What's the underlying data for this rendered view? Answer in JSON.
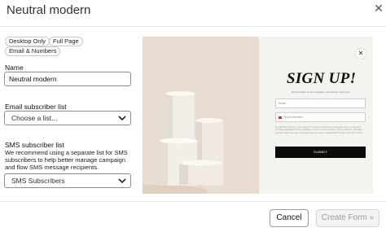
{
  "header": {
    "title": "Neutral modern",
    "close_glyph": "✕"
  },
  "tags": [
    "Desktop Only",
    "Full Page",
    "Email & Numbers"
  ],
  "form": {
    "name_label": "Name",
    "name_value": "Neutral modern",
    "email_list_label": "Email subscriber list",
    "email_list_value": "Choose a list...",
    "sms_list_label": "SMS subscriber list",
    "sms_help": "We recommend using a separate list for SMS subscribers to help better manage campaign and flow SMS message recipients.",
    "sms_list_value": "SMS Subscribers"
  },
  "preview": {
    "close_glyph": "✕",
    "heading": "SIGN UP!",
    "subtext": "Get the latest on new releases, promotions, and more.",
    "email_placeholder": "Email",
    "phone_placeholder": "Phone Number",
    "fine_print": "By submitting this form, you consent to receive marketing text messages from our company, including messages sent by autodialer. Consent is not a condition of any purchase. Message and data rates may apply. Message frequency varies. Reply HELP for help or STOP to cancel.",
    "submit_label": "SUBMIT",
    "colors": {
      "photo_bg": "#e8ddd0",
      "panel_bg": "#f5f3ef",
      "button": "#0c0c0c"
    }
  },
  "footer": {
    "cancel_label": "Cancel",
    "create_label": "Create Form »"
  }
}
